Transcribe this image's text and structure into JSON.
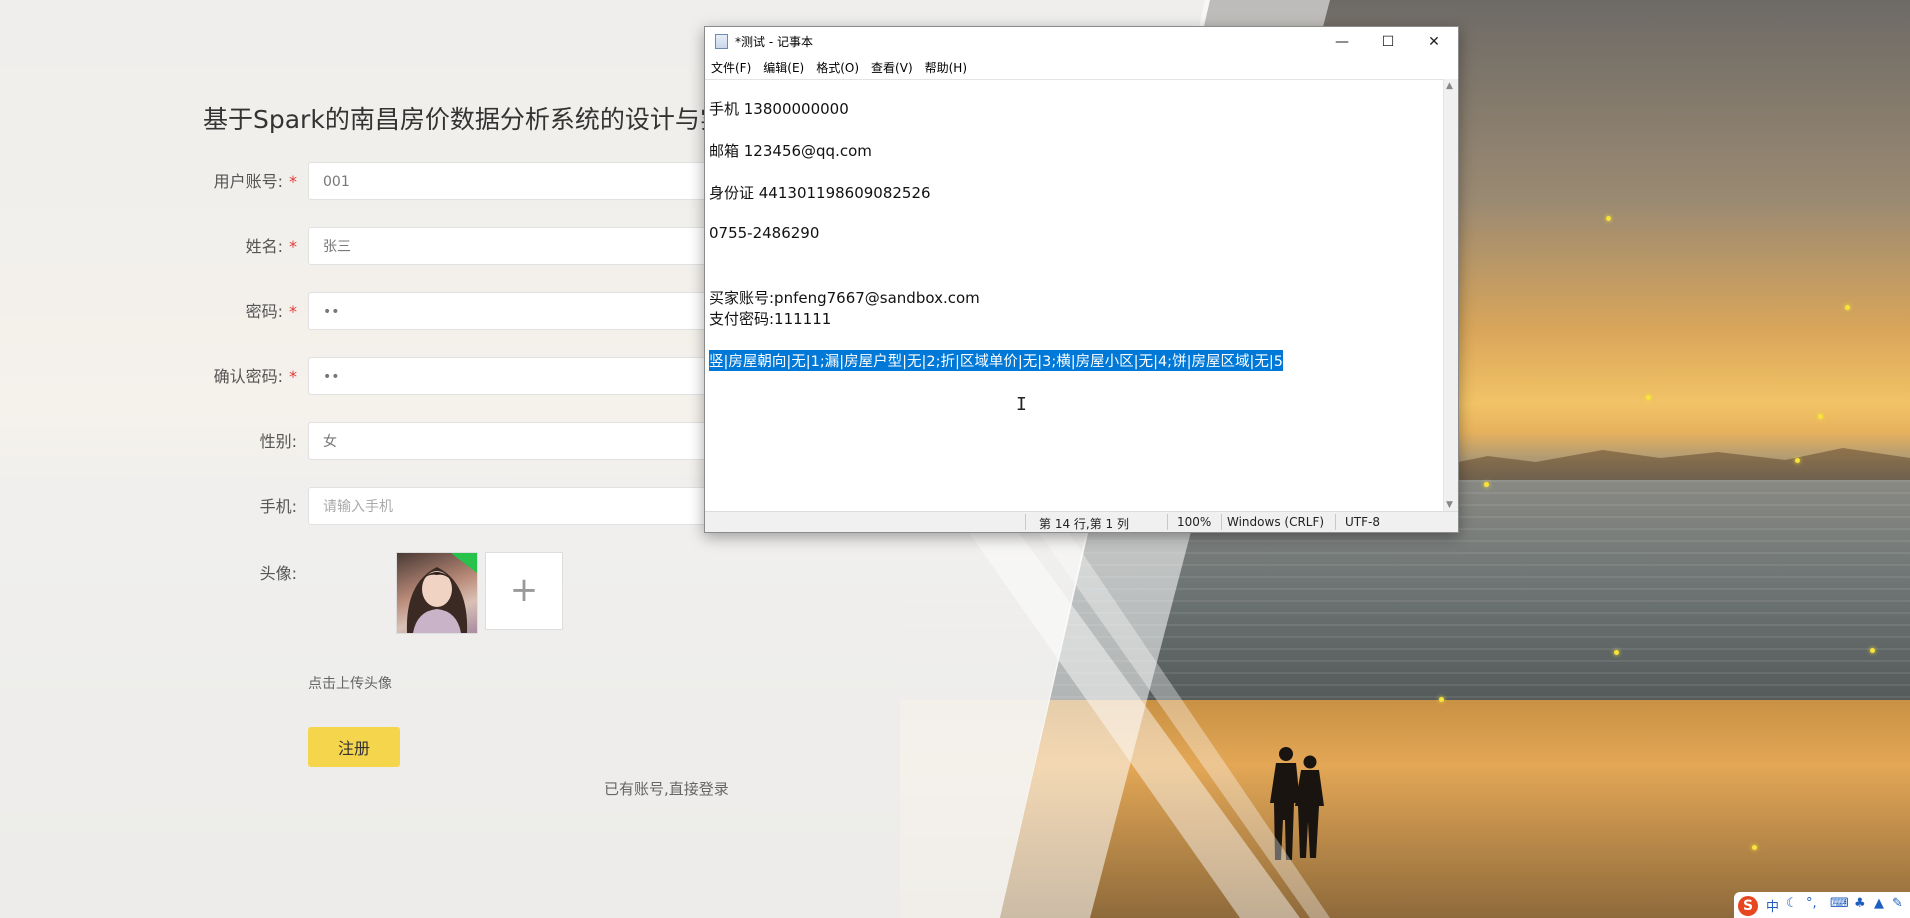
{
  "form": {
    "title": "基于Spark的南昌房价数据分析系统的设计与实现",
    "fields": [
      {
        "label": "用户账号:",
        "required": true,
        "value": "001",
        "placeholder": ""
      },
      {
        "label": "姓名:",
        "required": true,
        "value": "张三",
        "placeholder": ""
      },
      {
        "label": "密码:",
        "required": true,
        "value": "••",
        "placeholder": ""
      },
      {
        "label": "确认密码:",
        "required": true,
        "value": "••",
        "placeholder": ""
      },
      {
        "label": "性别:",
        "required": false,
        "value": "女",
        "placeholder": ""
      },
      {
        "label": "手机:",
        "required": false,
        "value": "",
        "placeholder": "请输入手机"
      }
    ],
    "required_mark": "*",
    "avatar_label": "头像:",
    "upload_plus": "+",
    "upload_hint": "点击上传头像",
    "register_label": "注册",
    "login_link": "已有账号,直接登录"
  },
  "notepad": {
    "title": "*测试 - 记事本",
    "menus": [
      "文件(F)",
      "编辑(E)",
      "格式(O)",
      "查看(V)",
      "帮助(H)"
    ],
    "window_buttons": {
      "minimize": "—",
      "maximize": "☐",
      "close": "✕"
    },
    "lines": [
      "手机 13800000000",
      "邮箱 123456@qq.com",
      "身份证 441301198609082526",
      "0755-2486290",
      "买家账号:pnfeng7667@sandbox.com",
      "支付密码:111111"
    ],
    "selected_line": "竖|房屋朝向|无|1;漏|房屋户型|无|2;折|区域单价|无|3;横|房屋小区|无|4;饼|房屋区域|无|5",
    "status": {
      "position": "第 14 行,第 1 列",
      "zoom": "100%",
      "line_ending": "Windows (CRLF)",
      "encoding": "UTF-8"
    }
  },
  "tray": {
    "ime_logo": "S",
    "ime_mode": "中",
    "icons": [
      "moon-icon",
      "punctuation-icon",
      "keyboard-icon",
      "skin-icon",
      "shirt-icon",
      "tools-icon"
    ]
  },
  "colors": {
    "accent_button": "#f5d54c",
    "required": "#e53935",
    "selection": "#0078d7"
  }
}
